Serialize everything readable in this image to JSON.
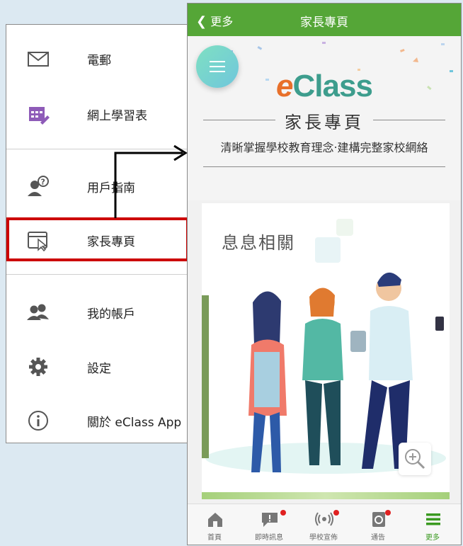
{
  "menu": {
    "items": [
      {
        "label": "電郵",
        "icon": "mail-icon"
      },
      {
        "label": "網上學習表",
        "icon": "learning-table-icon"
      },
      {
        "label": "用戶指南",
        "icon": "user-help-icon"
      },
      {
        "label": "家長專頁",
        "icon": "parent-page-icon"
      },
      {
        "label": "我的帳戶",
        "icon": "account-icon"
      },
      {
        "label": "設定",
        "icon": "gear-icon"
      },
      {
        "label": "關於 eClass App",
        "icon": "info-icon"
      }
    ]
  },
  "phone": {
    "topbar": {
      "back_label": "更多",
      "title": "家長專頁"
    },
    "logo": {
      "e": "e",
      "rest": "Class"
    },
    "subtitle": "家長專頁",
    "tagline": "清晰掌握學校教育理念‧建構完整家校網絡",
    "card_title": "息息相關",
    "tabs": [
      {
        "label": "首頁",
        "icon": "home-icon"
      },
      {
        "label": "即時訊息",
        "icon": "message-icon"
      },
      {
        "label": "學校宣佈",
        "icon": "broadcast-icon"
      },
      {
        "label": "通告",
        "icon": "notice-icon"
      },
      {
        "label": "更多",
        "icon": "more-icon"
      }
    ]
  },
  "colors": {
    "accent_green": "#55a637",
    "highlight_red": "#cc0000"
  }
}
